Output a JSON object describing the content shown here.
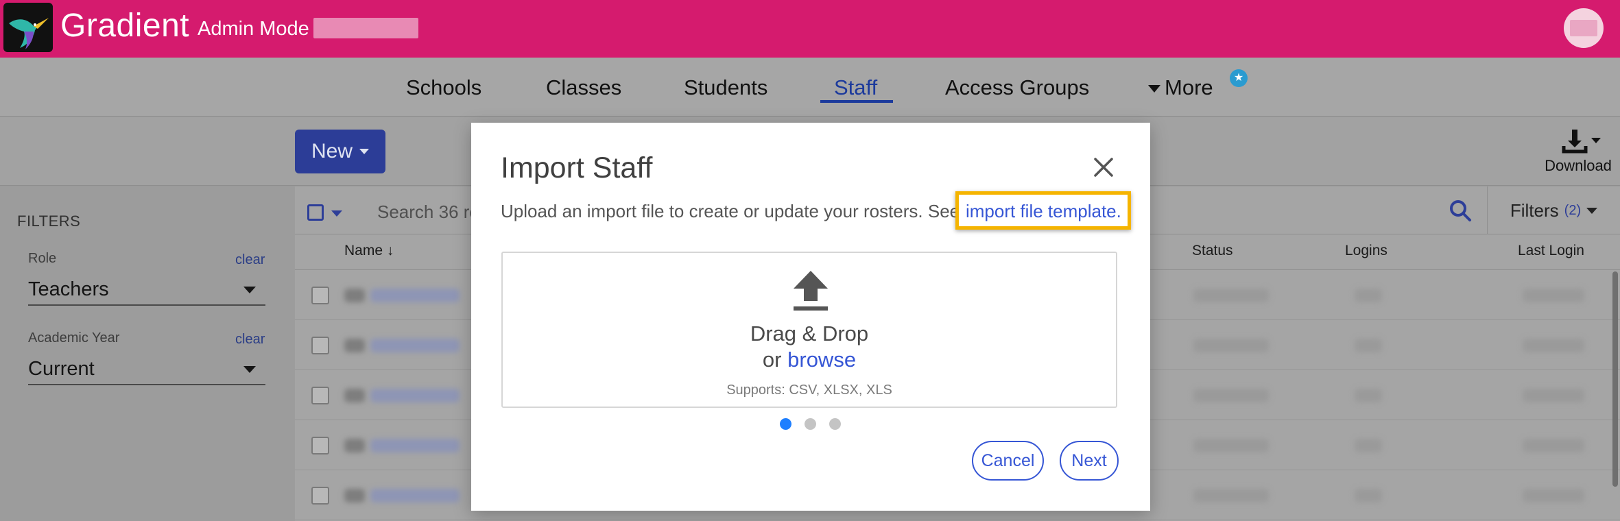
{
  "header": {
    "brand": "Gradient",
    "mode_label": "Admin Mode"
  },
  "nav": {
    "items": [
      {
        "label": "Schools"
      },
      {
        "label": "Classes"
      },
      {
        "label": "Students"
      },
      {
        "label": "Staff",
        "active": true
      },
      {
        "label": "Access Groups"
      },
      {
        "label": "More"
      }
    ]
  },
  "toolbar": {
    "new_label": "New",
    "download_label": "Download"
  },
  "sidebar": {
    "title": "FILTERS",
    "filters": [
      {
        "label": "Role",
        "clear": "clear",
        "value": "Teachers"
      },
      {
        "label": "Academic Year",
        "clear": "clear",
        "value": "Current"
      }
    ]
  },
  "table": {
    "search_placeholder": "Search 36 re",
    "filters_label": "Filters",
    "filters_count": "(2)",
    "columns": {
      "name": "Name",
      "status": "Status",
      "logins": "Logins",
      "last_login": "Last Login"
    },
    "row_count": 5
  },
  "modal": {
    "title": "Import Staff",
    "description": "Upload an import file to create or update your rosters. See the",
    "template_link": "import file template.",
    "drop_title": "Drag & Drop",
    "drop_or": "or",
    "browse_label": "browse",
    "supports": "Supports: CSV, XLSX, XLS",
    "steps_total": 3,
    "step_active": 1,
    "cancel_label": "Cancel",
    "next_label": "Next"
  },
  "colors": {
    "header_bg": "#d51b6e",
    "accent": "#3656d5",
    "highlight": "#f5b400"
  }
}
